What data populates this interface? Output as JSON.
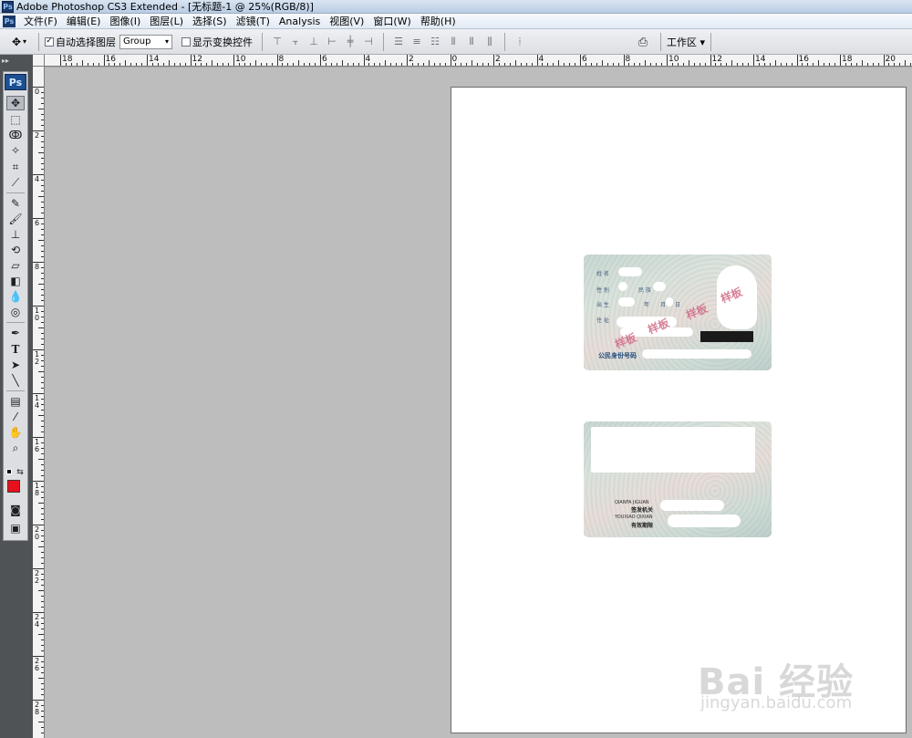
{
  "window": {
    "title": "Adobe Photoshop CS3 Extended - [无标题-1 @ 25%(RGB/8)]",
    "app_badge": "Ps"
  },
  "menu": {
    "items": [
      "文件(F)",
      "编辑(E)",
      "图像(I)",
      "图层(L)",
      "选择(S)",
      "滤镜(T)",
      "Analysis",
      "视图(V)",
      "窗口(W)",
      "帮助(H)"
    ]
  },
  "options": {
    "auto_select_label": "自动选择图层",
    "auto_select_checked": true,
    "group_value": "Group",
    "show_transform_label": "显示变换控件",
    "show_transform_checked": false,
    "workspace_label": "工作区 ▾"
  },
  "toolbox": {
    "logo": "Ps",
    "foreground_color": "#e8101d"
  },
  "rulers": {
    "horizontal_labels": [
      "18",
      "16",
      "14",
      "12",
      "10",
      "8",
      "6",
      "4",
      "2",
      "0",
      "2",
      "4",
      "6",
      "8",
      "10",
      "12",
      "14",
      "16",
      "18",
      "20"
    ],
    "vertical_labels": [
      "0",
      "2",
      "4",
      "6",
      "8",
      "1 0",
      "1 2",
      "1 4",
      "1 6",
      "1 8",
      "2 0",
      "2 2",
      "2 4",
      "2 6",
      "2 8"
    ]
  },
  "id_card_front": {
    "field_name": "姓 名",
    "field_gender": "性 别",
    "field_ethnicity": "民 族",
    "field_birth": "出 生",
    "field_birth_year": "年",
    "field_birth_month": "月",
    "field_birth_day": "日",
    "field_address": "住 址",
    "id_number_label": "公民身份号码",
    "stamp": "样板",
    "stamp2": "样板",
    "stamp3": "样板",
    "stamp4": "样板"
  },
  "id_card_back": {
    "authority_pinyin": "QIANFA JIGUAN",
    "authority_label": "签发机关",
    "validity_pinyin": "YOUXIAO QIXIAN",
    "validity_label": "有效期限"
  },
  "watermark": {
    "brand": "Bai 经验",
    "url": "jingyan.baidu.com"
  }
}
